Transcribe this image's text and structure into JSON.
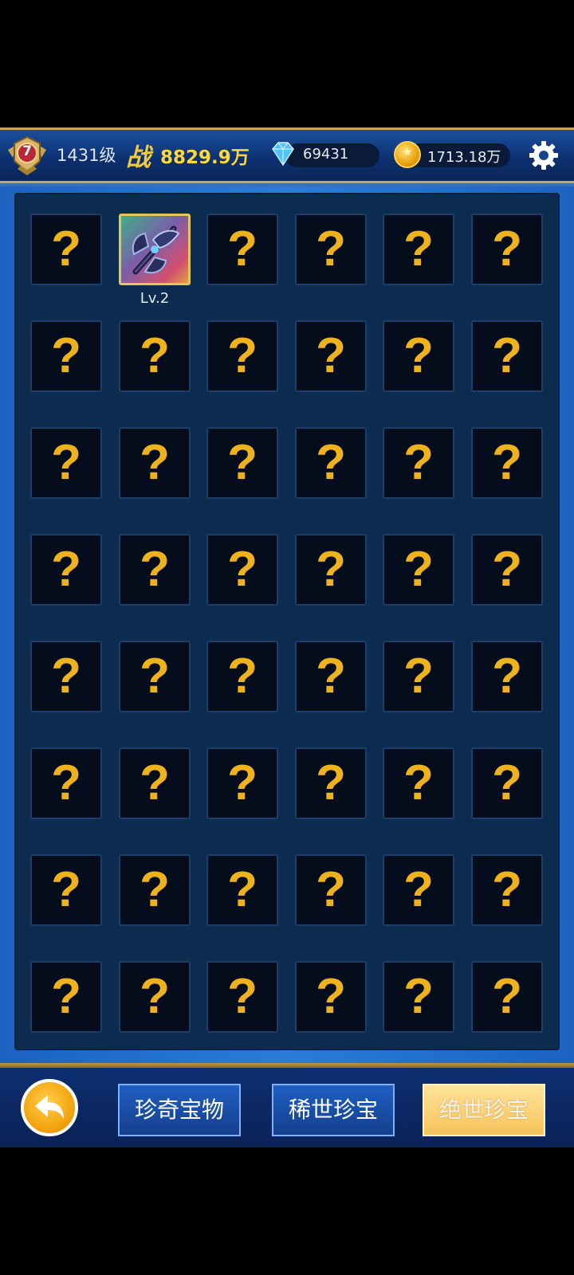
{
  "header": {
    "rank_number": "7",
    "level": "1431级",
    "power_label": "战",
    "power_value": "8829.9万",
    "gems": "69431",
    "gold": "1713.18万"
  },
  "collection": {
    "unknown_symbol": "?",
    "slots": [
      {
        "state": "locked"
      },
      {
        "state": "owned",
        "item": "battle-axe",
        "level": "Lv.2"
      },
      {
        "state": "locked"
      },
      {
        "state": "locked"
      },
      {
        "state": "locked"
      },
      {
        "state": "locked"
      },
      {
        "state": "locked"
      },
      {
        "state": "locked"
      },
      {
        "state": "locked"
      },
      {
        "state": "locked"
      },
      {
        "state": "locked"
      },
      {
        "state": "locked"
      },
      {
        "state": "locked"
      },
      {
        "state": "locked"
      },
      {
        "state": "locked"
      },
      {
        "state": "locked"
      },
      {
        "state": "locked"
      },
      {
        "state": "locked"
      },
      {
        "state": "locked"
      },
      {
        "state": "locked"
      },
      {
        "state": "locked"
      },
      {
        "state": "locked"
      },
      {
        "state": "locked"
      },
      {
        "state": "locked"
      },
      {
        "state": "locked"
      },
      {
        "state": "locked"
      },
      {
        "state": "locked"
      },
      {
        "state": "locked"
      },
      {
        "state": "locked"
      },
      {
        "state": "locked"
      },
      {
        "state": "locked"
      },
      {
        "state": "locked"
      },
      {
        "state": "locked"
      },
      {
        "state": "locked"
      },
      {
        "state": "locked"
      },
      {
        "state": "locked"
      },
      {
        "state": "locked"
      },
      {
        "state": "locked"
      },
      {
        "state": "locked"
      },
      {
        "state": "locked"
      },
      {
        "state": "locked"
      },
      {
        "state": "locked"
      },
      {
        "state": "locked"
      },
      {
        "state": "locked"
      },
      {
        "state": "locked"
      },
      {
        "state": "locked"
      },
      {
        "state": "locked"
      },
      {
        "state": "locked"
      }
    ]
  },
  "tabs": [
    {
      "label": "珍奇宝物",
      "active": false
    },
    {
      "label": "稀世珍宝",
      "active": false
    },
    {
      "label": "绝世珍宝",
      "active": true
    }
  ],
  "colors": {
    "accent_gold": "#eeb21c",
    "panel": "#0b2c4f",
    "frame_blue": "#2c7bd8"
  }
}
